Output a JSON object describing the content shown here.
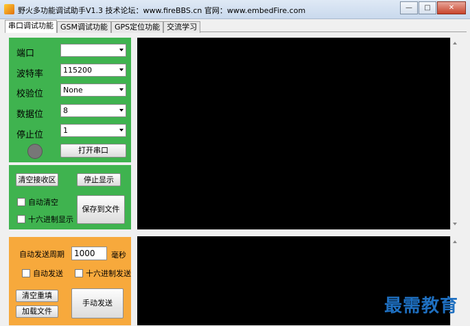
{
  "window": {
    "title": "野火多功能调试助手V1.3    技术论坛：www.fireBBS.cn    官网：www.embedFire.com",
    "min": "—",
    "max": "□",
    "close": "✕"
  },
  "tabs": [
    "串口调试功能",
    "GSM调试功能",
    "GPS定位功能",
    "交流学习"
  ],
  "serial": {
    "port_label": "端口",
    "port_value": "",
    "baud_label": "波特率",
    "baud_value": "115200",
    "parity_label": "校验位",
    "parity_value": "None",
    "databits_label": "数据位",
    "databits_value": "8",
    "stopbits_label": "停止位",
    "stopbits_value": "1",
    "open_button": "打开串口"
  },
  "receive": {
    "clear_button": "清空接收区",
    "stop_button": "停止显示",
    "auto_clear": "自动清空",
    "hex_display": "十六进制显示",
    "save_button": "保存到文件"
  },
  "send": {
    "period_label": "自动发送周期",
    "period_value": "1000",
    "unit": "毫秒",
    "auto_send": "自动发送",
    "hex_send": "十六进制发送",
    "clear_button": "清空重填",
    "load_button": "加载文件",
    "manual_button": "手动发送"
  },
  "watermark": "最需教育",
  "colors": {
    "panel_green": "#3fb34f",
    "panel_orange": "#f7a93c",
    "console_bg": "#000000"
  }
}
